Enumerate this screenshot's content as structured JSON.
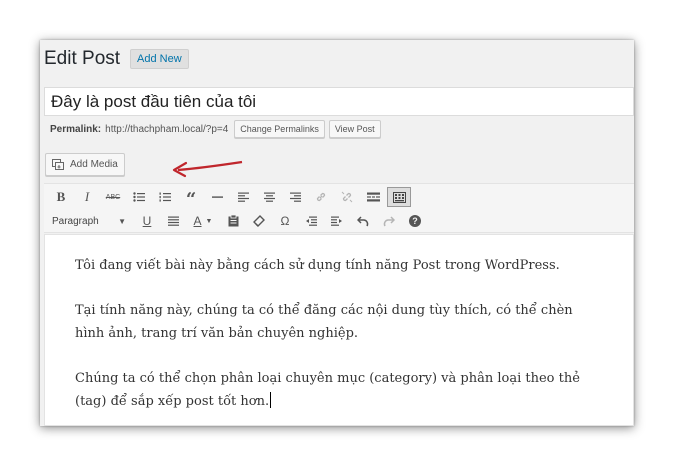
{
  "header": {
    "title": "Edit Post",
    "add_new_label": "Add New"
  },
  "post": {
    "title": "Đây là post đầu tiên của tôi"
  },
  "permalink": {
    "label": "Permalink:",
    "url": "http://thachpham.local/?p=4",
    "change_label": "Change Permalinks",
    "view_label": "View Post"
  },
  "media": {
    "add_media_label": "Add Media"
  },
  "toolbar": {
    "format_select_value": "Paragraph",
    "bold_label": "B",
    "italic_label": "I",
    "strike_label": "ABC",
    "blockquote_label": "“",
    "underline_label": "U",
    "text_color_label": "A",
    "omega_label": "Ω",
    "help_label": "?"
  },
  "content": {
    "paragraphs": [
      "Tôi đang viết bài này bằng cách sử dụng tính năng Post trong WordPress.",
      "Tại tính năng này, chúng ta có thể đăng các nội dung tùy thích, có thể chèn hình ảnh, trang trí văn bản chuyên nghiệp.",
      "Chúng ta có thể chọn phân loại chuyên mục (category) và phân loại theo thẻ (tag) để sắp xếp post tốt hơn."
    ]
  },
  "colors": {
    "accent": "#0073aa",
    "arrow": "#c0262c"
  }
}
